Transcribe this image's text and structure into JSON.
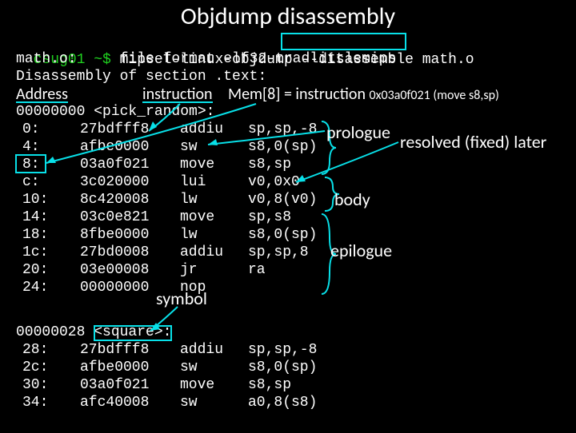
{
  "title": "Objdump disassembly",
  "prompt": {
    "host": "csug01 ~$",
    "cmd": "mipsel-linux-objdump",
    "flag": "--disassemble",
    "arg": "math.o"
  },
  "lines": {
    "fileinfo": "math.o:     file format elf32-tradlittlemips",
    "section": "Disassembly of section .text:"
  },
  "headers": {
    "address": "Address",
    "instruction": "instruction",
    "mem": "Mem[8] = instruction",
    "example": "0x03a0f021 (move s8,sp)"
  },
  "symbols": {
    "pick": "00000000 <pick_random>:",
    "square": "00000028 <square>:"
  },
  "annotations": {
    "prologue": "prologue",
    "body": "body",
    "epilogue": "epilogue",
    "symbol": "symbol",
    "resolved": "resolved (fixed) later"
  },
  "rows1": [
    {
      "addr": "0:",
      "hex": "27bdfff8",
      "op": "addiu",
      "args": "sp,sp,-8"
    },
    {
      "addr": "4:",
      "hex": "afbe0000",
      "op": "sw",
      "args": "s8,0(sp)"
    },
    {
      "addr": "8:",
      "hex": "03a0f021",
      "op": "move",
      "args": "s8,sp"
    },
    {
      "addr": "c:",
      "hex": "3c020000",
      "op": "lui",
      "args": "v0,0x0"
    },
    {
      "addr": "10:",
      "hex": "8c420008",
      "op": "lw",
      "args": "v0,8(v0)"
    },
    {
      "addr": "14:",
      "hex": "03c0e821",
      "op": "move",
      "args": "sp,s8"
    },
    {
      "addr": "18:",
      "hex": "8fbe0000",
      "op": "lw",
      "args": "s8,0(sp)"
    },
    {
      "addr": "1c:",
      "hex": "27bd0008",
      "op": "addiu",
      "args": "sp,sp,8"
    },
    {
      "addr": "20:",
      "hex": "03e00008",
      "op": "jr",
      "args": "ra"
    },
    {
      "addr": "24:",
      "hex": "00000000",
      "op": "nop",
      "args": ""
    }
  ],
  "rows2": [
    {
      "addr": "28:",
      "hex": "27bdfff8",
      "op": "addiu",
      "args": "sp,sp,-8"
    },
    {
      "addr": "2c:",
      "hex": "afbe0000",
      "op": "sw",
      "args": "s8,0(sp)"
    },
    {
      "addr": "30:",
      "hex": "03a0f021",
      "op": "move",
      "args": "s8,sp"
    },
    {
      "addr": "34:",
      "hex": "afc40008",
      "op": "sw",
      "args": "a0,8(s8)"
    }
  ]
}
